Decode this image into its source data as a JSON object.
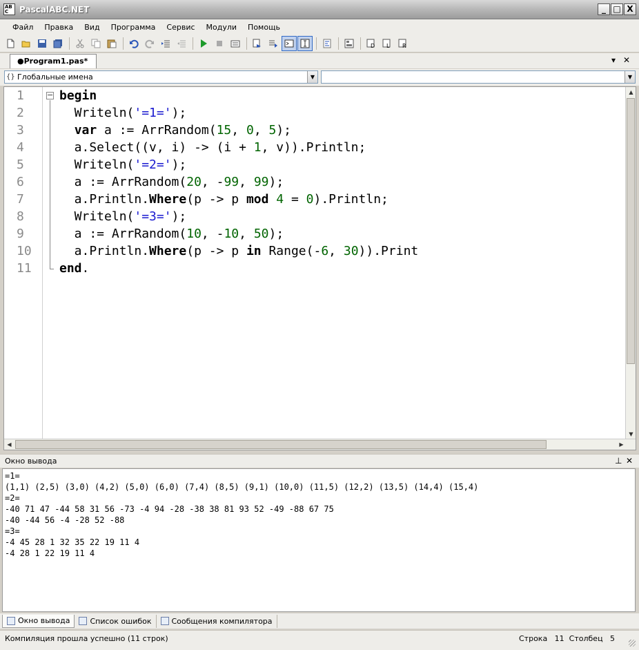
{
  "window": {
    "title": "PascalABC.NET",
    "controls": [
      "_",
      "□",
      "X"
    ]
  },
  "menu": [
    "Файл",
    "Правка",
    "Вид",
    "Программа",
    "Сервис",
    "Модули",
    "Помощь"
  ],
  "document_tab": {
    "label": "●Program1.pas*"
  },
  "combos": {
    "left": "Глобальные имена",
    "right": ""
  },
  "editor": {
    "line_numbers": [
      "1",
      "2",
      "3",
      "4",
      "5",
      "6",
      "7",
      "8",
      "9",
      "10",
      "11"
    ]
  },
  "output_panel": {
    "title": "Окно вывода",
    "lines": [
      "=1=",
      "(1,1) (2,5) (3,0) (4,2) (5,0) (6,0) (7,4) (8,5) (9,1) (10,0) (11,5) (12,2) (13,5) (14,4) (15,4)",
      "=2=",
      "-40 71 47 -44 58 31 56 -73 -4 94 -28 -38 38 81 93 52 -49 -88 67 75",
      "-40 -44 56 -4 -28 52 -88",
      "=3=",
      "-4 45 28 1 32 35 22 19 11 4",
      "-4 28 1 22 19 11 4"
    ]
  },
  "bottom_tabs": [
    "Окно вывода",
    "Список ошибок",
    "Сообщения компилятора"
  ],
  "status": {
    "message": "Компиляция прошла успешно (11 строк)",
    "position": "Строка   11  Столбец   5"
  }
}
